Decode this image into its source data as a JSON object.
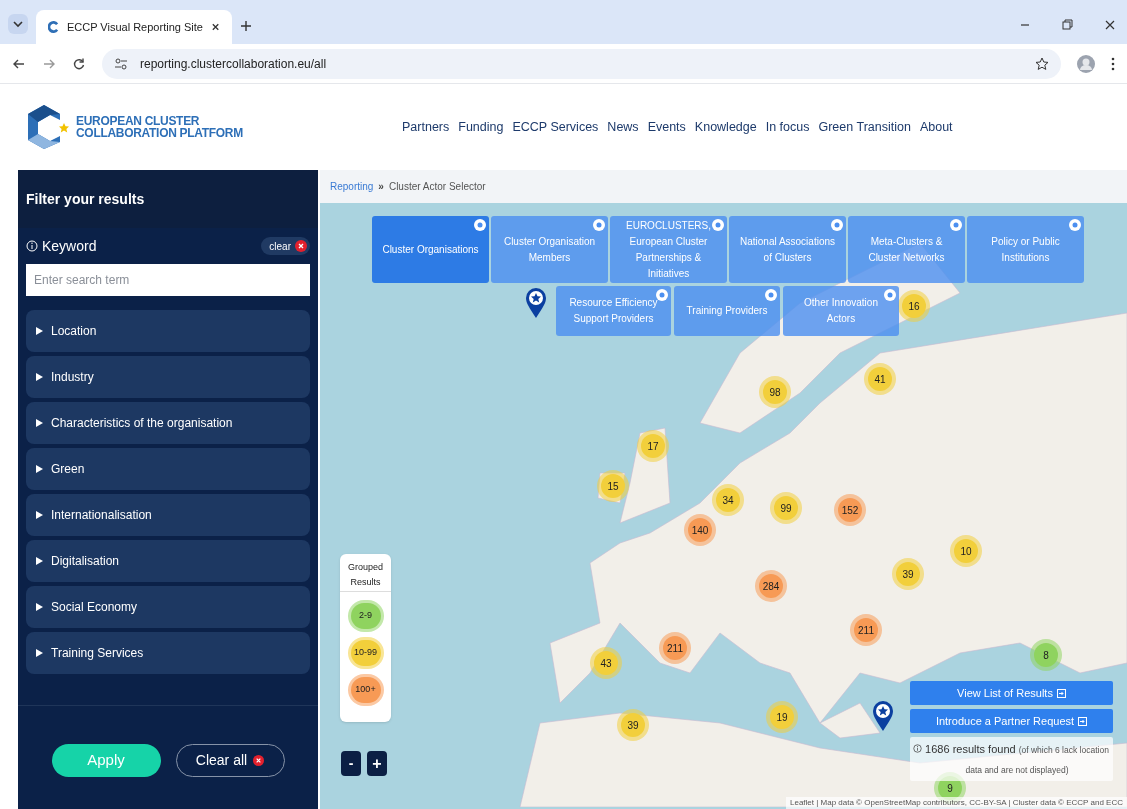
{
  "browser": {
    "tab_title": "ECCP Visual Reporting Site",
    "url": "reporting.clustercollaboration.eu/all"
  },
  "header": {
    "logo_lines": [
      "EUROPEAN CLUSTER",
      "COLLABORATION PLATFORM"
    ],
    "nav": [
      "Partners",
      "Funding",
      "ECCP Services",
      "News",
      "Events",
      "Knowledge",
      "In focus",
      "Green Transition",
      "About"
    ]
  },
  "sidebar": {
    "title": "Filter your results",
    "keyword": {
      "label": "Keyword",
      "clear": "clear",
      "placeholder": "Enter search term"
    },
    "filters": [
      {
        "label": "Location",
        "expanded": false
      },
      {
        "label": "Industry",
        "expanded": false
      },
      {
        "label": "Characteristics of the organisation",
        "expanded": false
      },
      {
        "label": "Green",
        "expanded": false
      },
      {
        "label": "Internationalisation",
        "expanded": false
      },
      {
        "label": "Digitalisation",
        "expanded": false
      },
      {
        "label": "Social Economy",
        "expanded": false
      },
      {
        "label": "Training Services",
        "expanded": false
      }
    ],
    "apply": "Apply",
    "clear_all": "Clear all"
  },
  "breadcrumb": {
    "link": "Reporting",
    "separator": "»",
    "current": "Cluster Actor Selector"
  },
  "actor_types": [
    {
      "label": "Cluster Organisations",
      "selected": true
    },
    {
      "label": "Cluster Organisation Members",
      "selected": false
    },
    {
      "label": "EUROCLUSTERS, European Cluster Partnerships & Initiatives",
      "selected": false
    },
    {
      "label": "National Associations of Clusters",
      "selected": false
    },
    {
      "label": "Meta-Clusters & Cluster Networks",
      "selected": false
    },
    {
      "label": "Policy or Public Institutions",
      "selected": false
    },
    {
      "label": "Resource Efficiency Support Providers",
      "selected": false
    },
    {
      "label": "Training Providers",
      "selected": false
    },
    {
      "label": "Other Innovation Actors",
      "selected": false
    }
  ],
  "legend": {
    "title": "Grouped Results",
    "items": [
      {
        "label": "2-9",
        "color": "#8fd35f"
      },
      {
        "label": "10-99",
        "color": "#f2cf3b"
      },
      {
        "label": "100+",
        "color": "#f79a55"
      }
    ]
  },
  "zoom": {
    "out": "-",
    "in": "+"
  },
  "clusters": [
    {
      "count": "16",
      "color": "#f2cf3b"
    },
    {
      "count": "41",
      "color": "#f2cf3b"
    },
    {
      "count": "98",
      "color": "#f2cf3b"
    },
    {
      "count": "17",
      "color": "#f2cf3b"
    },
    {
      "count": "15",
      "color": "#f2cf3b"
    },
    {
      "count": "34",
      "color": "#f2cf3b"
    },
    {
      "count": "99",
      "color": "#f2cf3b"
    },
    {
      "count": "152",
      "color": "#f79a55"
    },
    {
      "count": "140",
      "color": "#f79a55"
    },
    {
      "count": "10",
      "color": "#f2cf3b"
    },
    {
      "count": "39",
      "color": "#f2cf3b"
    },
    {
      "count": "284",
      "color": "#f79a55"
    },
    {
      "count": "211",
      "color": "#f79a55"
    },
    {
      "count": "211",
      "color": "#f79a55"
    },
    {
      "count": "43",
      "color": "#f2cf3b"
    },
    {
      "count": "39",
      "color": "#f2cf3b"
    },
    {
      "count": "19",
      "color": "#f2cf3b"
    },
    {
      "count": "8",
      "color": "#8fd35f"
    },
    {
      "count": "9",
      "color": "#8fd35f"
    }
  ],
  "actions": [
    "View List of Results",
    "Introduce a Partner Request"
  ],
  "results": {
    "count": "1686 results found",
    "note": "(of which 6 lack location data and are not displayed)"
  },
  "attribution": "Leaflet | Map data © OpenStreetMap contributors, CC-BY-SA | Cluster data © ECCP and ECC"
}
